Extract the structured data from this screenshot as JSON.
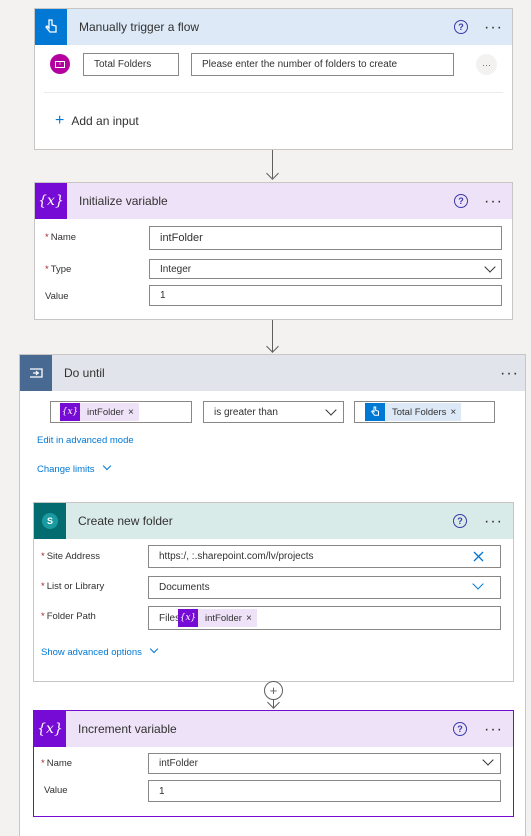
{
  "trigger": {
    "title": "Manually trigger a flow",
    "input_name": "Total Folders",
    "input_description": "Please enter the number of folders to create",
    "add_input_label": "Add an input"
  },
  "init_variable": {
    "title": "Initialize variable",
    "name_label": "Name",
    "name_value": "intFolder",
    "type_label": "Type",
    "type_value": "Integer",
    "value_label": "Value",
    "value_value": "1"
  },
  "do_until": {
    "title": "Do until",
    "left_token": "intFolder",
    "operator": "is greater than",
    "right_token": "Total Folders",
    "advanced_mode_link": "Edit in advanced mode",
    "change_limits_link": "Change limits"
  },
  "create_folder": {
    "title": "Create new folder",
    "site_label": "Site Address",
    "site_value": "https:/,          :.sharepoint.com/lv/projects",
    "list_label": "List or Library",
    "list_value": "Documents",
    "path_label": "Folder Path",
    "path_prefix": "Files",
    "path_token": "intFolder",
    "advanced_link": "Show advanced options"
  },
  "increment": {
    "title": "Increment variable",
    "name_label": "Name",
    "name_value": "intFolder",
    "value_label": "Value",
    "value_value": "1"
  },
  "common": {
    "required_mark": "*",
    "help_glyph": "?",
    "more_glyph": "···",
    "remove_glyph": "×",
    "add_glyph": "+",
    "var_glyph": "{x}",
    "trigger_input_icon_text": "T"
  },
  "colors": {
    "trigger_header": "#dde9f7",
    "trigger_icon": "#0078d4",
    "variable_header": "#eee2f8",
    "variable_icon": "#770bd6",
    "control_header": "#e1e4ea",
    "control_icon": "#486991",
    "sharepoint_header": "#d9ebe9",
    "sharepoint_icon": "#036c70"
  }
}
